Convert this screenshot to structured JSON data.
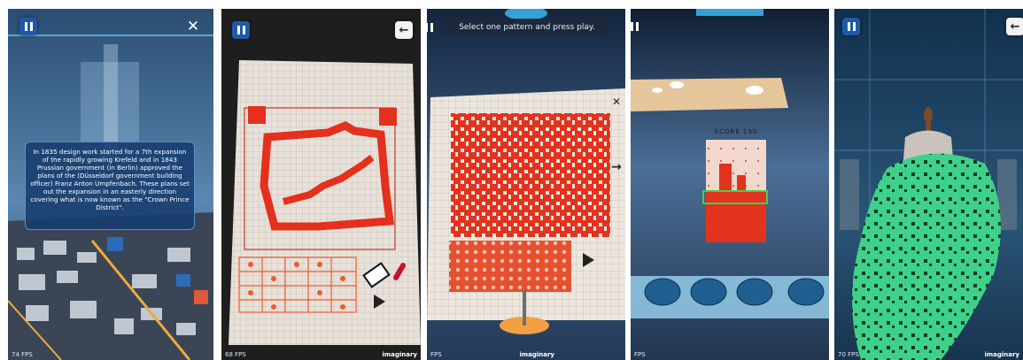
{
  "panel1": {
    "info_text": "In 1835 design work started for a 7th expansion of the rapidly growing Krefeld and in 1843 Prussian government (in Berlin) approved the plans of the (Düsseldorf government building officer) Franz Anton Umpfenbach. These plans set out the expansion in an easterly direction covering what is now known as the \"Crown Prince District\".",
    "fps": "74 FPS",
    "close_symbol": "✕"
  },
  "panel2": {
    "fps": "68 FPS",
    "logo": "imaginary",
    "back_symbol": "←"
  },
  "panel3": {
    "message": "Select one pattern and press play.",
    "fps": "FPS",
    "logo": "imaginary",
    "close_symbol": "✕"
  },
  "panel4": {
    "score_label": "SCORE 190",
    "fps": "FPS"
  },
  "panel5": {
    "fps": "70 FPS",
    "logo": "imaginary",
    "back_symbol": "←"
  }
}
